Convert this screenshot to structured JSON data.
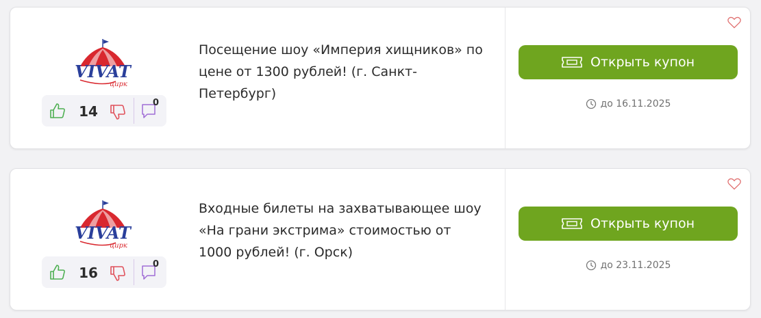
{
  "colors": {
    "accent": "#6fa51f",
    "like": "#4caf50",
    "dislike": "#e0505a",
    "heart": "#e07070"
  },
  "coupons": [
    {
      "brand_logo_text": "VIVAT",
      "brand_logo_subtext": "цирк",
      "likes": "14",
      "comments": "0",
      "description": "Посещение шоу «Империя хищников» по цене от 1300 рублей! (г. Санкт-Петербург)",
      "button_label": "Открыть купон",
      "expiry": "до 16.11.2025",
      "icons": [
        "thumbs-up-icon",
        "thumbs-down-icon",
        "comment-icon",
        "heart-icon",
        "ticket-icon",
        "clock-icon"
      ]
    },
    {
      "brand_logo_text": "VIVAT",
      "brand_logo_subtext": "цирк",
      "likes": "16",
      "comments": "0",
      "description": "Входные билеты на захватывающее шоу «На грани экстрима» стоимостью от 1000 рублей! (г. Орск)",
      "button_label": "Открыть купон",
      "expiry": "до 23.11.2025",
      "icons": [
        "thumbs-up-icon",
        "thumbs-down-icon",
        "comment-icon",
        "heart-icon",
        "ticket-icon",
        "clock-icon"
      ]
    }
  ]
}
